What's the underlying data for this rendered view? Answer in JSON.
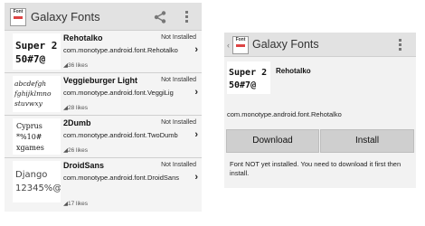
{
  "app": {
    "title": "Galaxy Fonts",
    "icon_text": "Font",
    "icon_name": "galaxy-fonts-app-icon",
    "share_icon": "share-icon",
    "menu_icon": "overflow-menu-icon"
  },
  "font_list": [
    {
      "name": "Rehotalko",
      "status": "Not Installed",
      "package": "com.monotype.android.font.Rehotalko",
      "likes": "36 likes",
      "preview": [
        "Super 2",
        "50#7@"
      ]
    },
    {
      "name": "Veggieburger Light",
      "status": "Not Installed",
      "package": "com.monotype.android.font.VeggiLig",
      "likes": "28 likes",
      "preview": [
        "abcdefgh",
        "fghijklmno",
        "stuvwxy"
      ]
    },
    {
      "name": "2Dumb",
      "status": "Not Installed",
      "package": "com.monotype.android.font.TwoDumb",
      "likes": "26 likes",
      "preview": [
        "Cyprus",
        "*%10#",
        "xgames"
      ]
    },
    {
      "name": "DroidSans",
      "status": "Not Installed",
      "package": "com.monotype.android.font.DroidSans",
      "likes": "17 likes",
      "preview": [
        "Django",
        "12345%@"
      ]
    }
  ],
  "detail": {
    "name": "Rehotalko",
    "package": "com.monotype.android.font.Rehotalko",
    "preview": [
      "Super 2",
      "50#7@"
    ],
    "download_label": "Download",
    "install_label": "Install",
    "message": "Font NOT yet installed. You need to download it first then install."
  }
}
